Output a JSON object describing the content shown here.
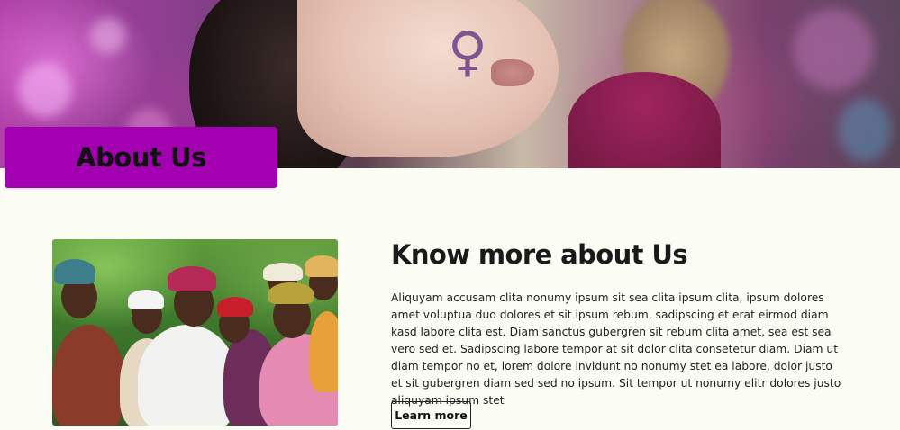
{
  "hero": {
    "image_subject": "woman-with-venus-symbol-face-paint",
    "symbol_glyph": "♀"
  },
  "about": {
    "title": "About Us"
  },
  "section": {
    "heading": "Know more about Us",
    "body": "Aliquyam accusam clita nonumy ipsum sit sea clita ipsum clita, ipsum dolores amet voluptua duo dolores et sit ipsum rebum, sadipscing et erat eirmod diam kasd labore clita est. Diam sanctus gubergren sit rebum clita amet, sea est sea vero sed et. Sadipscing labore tempor at sit dolor clita consetetur diam. Diam ut diam tempor no et, lorem dolore invidunt no nonumy stet ea labore, dolor justo et sit gubergren diam sed sed no ipsum. Sit tempor ut nonumy elitr dolores justo aliquyam ipsum stet",
    "button_label": "Learn more",
    "photo_subject": "group-of-smiling-women-outdoors"
  },
  "colors": {
    "accent": "#a200b1",
    "page_background": "#fbfcf4",
    "text": "#212529"
  }
}
